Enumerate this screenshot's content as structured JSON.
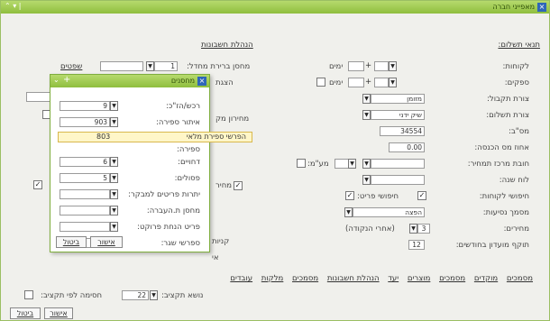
{
  "window": {
    "title": "מאפייני חברה",
    "controls": "| ▾ ⌃"
  },
  "left_section": {
    "heading": "תנאי תשלום:",
    "rows": [
      {
        "label": "לקוחות:",
        "value": "",
        "unit": "ימים"
      },
      {
        "label": "ספקים:",
        "value": "",
        "unit": "ימים"
      },
      {
        "label": "צורת תקבול:",
        "value": "מזומן"
      },
      {
        "label": "צורת תשלום:",
        "value": "שיק ידני"
      },
      {
        "label": "מס\"ב:",
        "value": "34554"
      },
      {
        "label": "אחוז מס הכנסה:",
        "value": "0.00"
      },
      {
        "label": "חובת מרכז תמחיר:",
        "value": "",
        "suffix": "מע\"מ:"
      },
      {
        "label": "לוח שנה:",
        "value": ""
      },
      {
        "label": "חיפושי לקוחות:",
        "suffix": "חיפושי פריט:"
      },
      {
        "label": "מסמך נסיעות:",
        "value": "הפצה"
      },
      {
        "label": "מחירים:",
        "value": "3",
        "suffix": "(אחרי הנקודה)"
      },
      {
        "label": "תוקף מועדון בחודשים:",
        "value": "12"
      }
    ]
  },
  "right_section": {
    "heading": "הנהלת חשבונות",
    "warehouse_label": "מחסן ברירת מחדל:",
    "warehouse_value": "1",
    "warehouse_link": "שפטים",
    "partial_labels": [
      "הצגת",
      "מחירון מק",
      "מחיר",
      "קניות",
      "אי"
    ],
    "bottom_label": "נושא תקציב:",
    "bottom_value": "22",
    "bottom_suffix": "חסימה לפי תקציב:"
  },
  "tabs": [
    "מסמכים",
    "מוקדים",
    "מסמכים",
    "מוצרים",
    "יעד",
    "הנהלת חשבונות",
    "מסמכים",
    "מלקות",
    "עובדים"
  ],
  "popup": {
    "title": "מחסנים",
    "rows": [
      {
        "label": "רכש/הז\"כ:",
        "value": "9"
      },
      {
        "label": "איתור ספירה:",
        "value": "903"
      },
      {
        "label": "ספירה:",
        "value": ""
      },
      {
        "label": "דחויים:",
        "value": "6"
      },
      {
        "label": "פסולים:",
        "value": "5"
      },
      {
        "label": "יתרות פריטים למבקר:",
        "value": ""
      },
      {
        "label": "מחסן ת.העברה:",
        "value": ""
      },
      {
        "label": "פריט הנחת פרוקט:",
        "value": ""
      },
      {
        "label": "ספרשי שגר:",
        "value": ""
      }
    ],
    "suggestion_value": "803",
    "suggestion_text": "הפרשי ספירת מלאי",
    "ok_label": "אישור",
    "cancel_label": "ביטול"
  },
  "footer": {
    "ok_label": "אישור",
    "cancel_label": "ביטול"
  }
}
